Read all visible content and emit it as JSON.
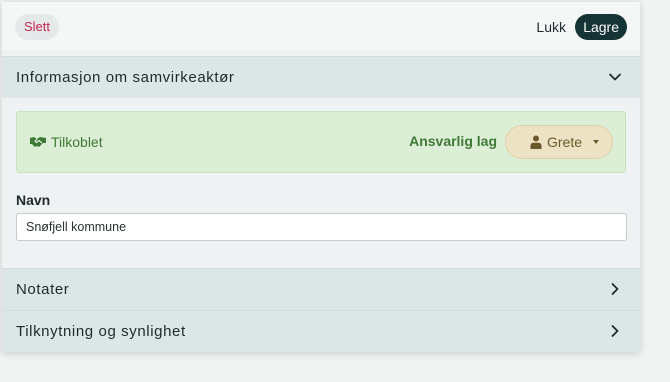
{
  "toolbar": {
    "delete_label": "Slett",
    "close_label": "Lukk",
    "save_label": "Lagre"
  },
  "section_info": {
    "title": "Informasjon om samvirkeaktør",
    "expanded": true,
    "status": {
      "icon": "handshake-icon",
      "label": "Tilkoblet",
      "responsible_label": "Ansvarlig lag",
      "owner": "Grete"
    },
    "name_field": {
      "label": "Navn",
      "value": "Snøfjell kommune"
    }
  },
  "section_notes": {
    "title": "Notater",
    "expanded": false
  },
  "section_affiliation": {
    "title": "Tilknytning og synlighet",
    "expanded": false
  },
  "colors": {
    "save_bg": "#163336",
    "delete_text": "#c4264f",
    "status_bg": "#ddeed7",
    "status_text": "#3e7a35",
    "owner_bg": "#ede3c4"
  }
}
